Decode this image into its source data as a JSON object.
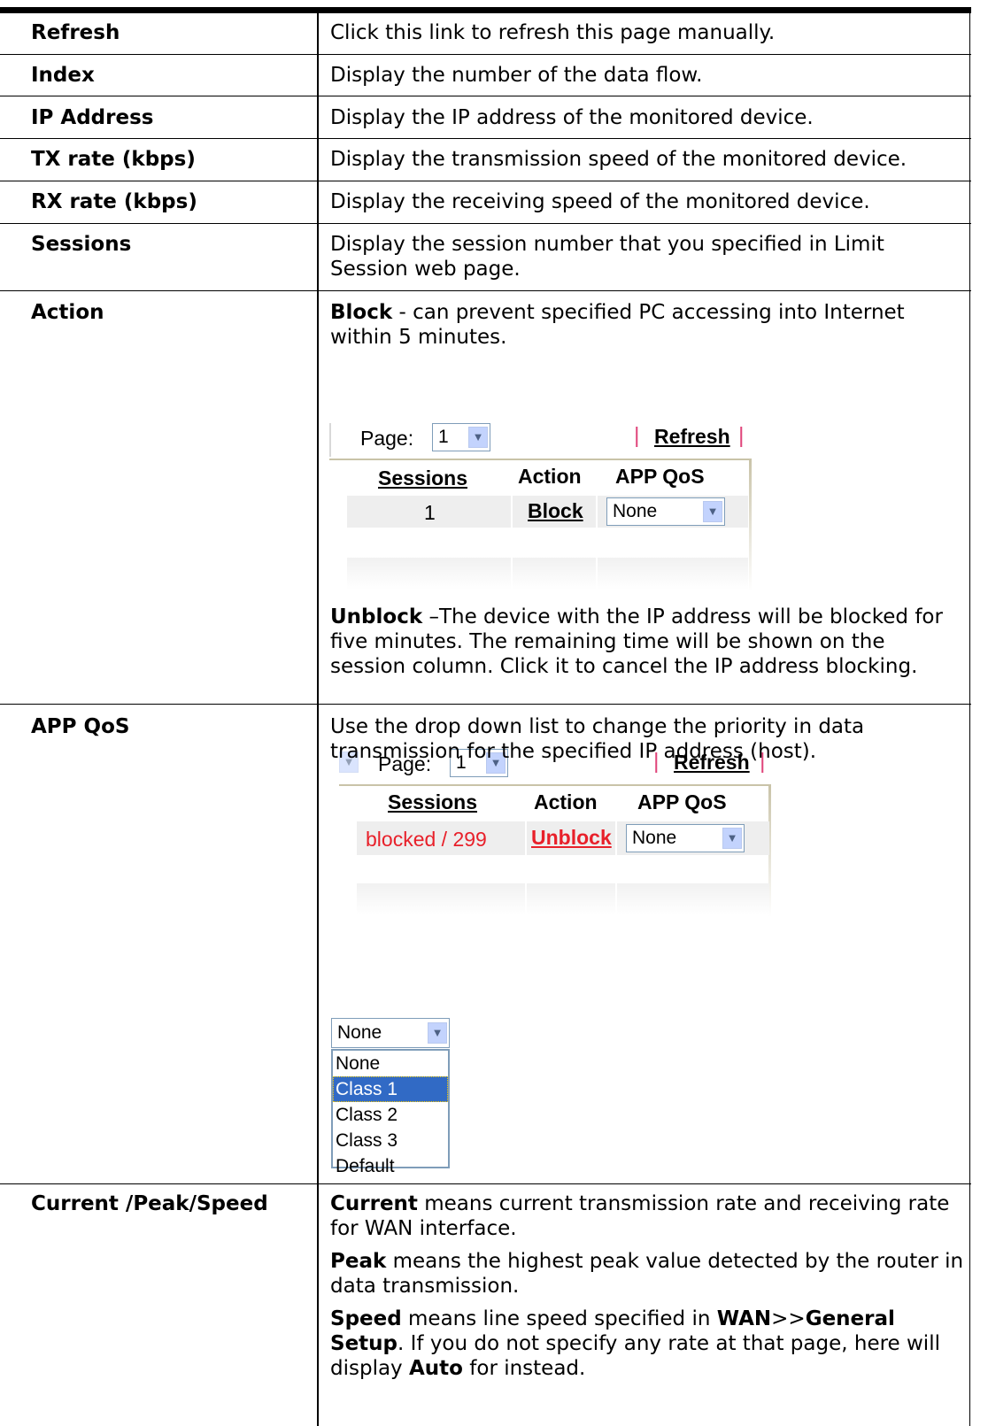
{
  "rows": [
    {
      "label": "Refresh",
      "desc": "Click this link to refresh this page manually."
    },
    {
      "label": "Index",
      "desc": "Display the number of the data flow."
    },
    {
      "label": "IP Address",
      "desc": "Display the IP address of the monitored device."
    },
    {
      "label": "TX rate (kbps)",
      "desc": "Display the transmission speed of the monitored device."
    },
    {
      "label": "RX rate (kbps)",
      "desc": "Display the receiving speed of the monitored device."
    },
    {
      "label": "Sessions",
      "desc": "Display the session number that you specified in Limit Session web page."
    },
    {
      "label": "Action"
    },
    {
      "label": "APP QoS",
      "desc": "Use the drop down list to change the priority in data transmission for the specified IP address (host)."
    },
    {
      "label": "Current /Peak/Speed"
    }
  ],
  "action": {
    "block_term": "Block",
    "block_text": " - can prevent specified PC accessing into Internet within 5 minutes.",
    "unblock_term": "Unblock",
    "unblock_text": " –The device with the IP address will be blocked for five minutes. The remaining time will be shown on the session column. Click it to cancel the IP address blocking."
  },
  "snapshot1": {
    "page_label": "Page:",
    "page_value": "1",
    "pipe": "|",
    "refresh": "Refresh",
    "col_sessions": "Sessions",
    "col_action": "Action",
    "col_qos": "APP QoS",
    "sessions_value": "1",
    "action_value": "Block",
    "qos_value": "None"
  },
  "snapshot2": {
    "page_label": "Page:",
    "page_value": "1",
    "pipe": "|",
    "refresh": "Refresh",
    "col_sessions": "Sessions",
    "col_action": "Action",
    "col_qos": "APP QoS",
    "sessions_value": "blocked / 299",
    "action_value": "Unblock",
    "qos_value": "None"
  },
  "qos_dropdown": {
    "value": "None",
    "options": [
      "None",
      "Class 1",
      "Class 2",
      "Class 3",
      "Default"
    ],
    "highlighted": "Class 1"
  },
  "cps": {
    "current_term": "Current",
    "current_text": " means current transmission rate and receiving rate for WAN interface.",
    "peak_term": "Peak",
    "peak_text": " means the highest peak value detected by the router in data transmission.",
    "speed_term": "Speed",
    "speed_text_1": " means line speed specified in ",
    "speed_menu_1": "WAN",
    "speed_sep": ">>",
    "speed_menu_2": "General Setup",
    "speed_text_2": ". If you do not specify any rate at that page, here will display ",
    "auto_term": "Auto",
    "speed_text_3": " for instead."
  },
  "colors": {
    "link_red": "#e8202a",
    "pipe_pink": "#e0457b",
    "highlight": "#316ac5"
  }
}
